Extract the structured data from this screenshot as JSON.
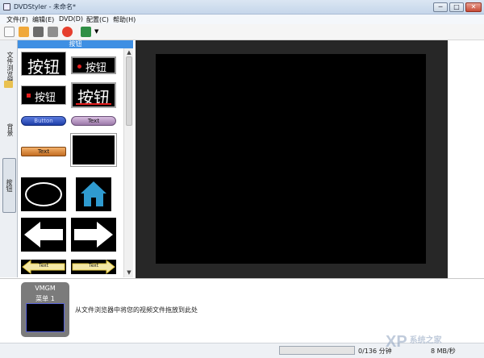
{
  "window": {
    "title": "DVDStyler - 未命名*",
    "min": "─",
    "max": "□",
    "close": "✕"
  },
  "menu": [
    {
      "label": "文件(F)"
    },
    {
      "label": "编辑(E)"
    },
    {
      "label": "DVD(D)"
    },
    {
      "label": "配置(C)"
    },
    {
      "label": "帮助(H)"
    }
  ],
  "toolbar": {
    "buttons": [
      "new-file-icon",
      "open-folder-icon",
      "save-icon",
      "settings-icon",
      "burn-icon",
      "add-file-icon"
    ],
    "colors": {
      "new": "#fafafa",
      "open": "#f0a83a",
      "save": "#6b6b6b",
      "settings": "#8f8f8f",
      "burn": "#e63f2e",
      "add": "#2f8f46"
    }
  },
  "left_tabs": [
    {
      "label": "文件浏览器"
    },
    {
      "label": "背景"
    },
    {
      "label": "按钮"
    }
  ],
  "panel": {
    "header": "按钮",
    "buttons": [
      {
        "text": "按钮",
        "style": "big"
      },
      {
        "text": "按钮",
        "style": "red-dot"
      },
      {
        "text": "按钮",
        "style": "red-dot-small"
      },
      {
        "text": "按钮",
        "style": "big-underline"
      },
      {
        "text": "Button",
        "style": "blue-pill"
      },
      {
        "text": "Text",
        "style": "purple-pill"
      },
      {
        "text": "Text",
        "style": "orange-pill"
      },
      {
        "text": "",
        "style": "black-frame"
      },
      {
        "text": "",
        "style": "ellipse"
      },
      {
        "text": "",
        "style": "house"
      },
      {
        "text": "",
        "style": "arrow-left"
      },
      {
        "text": "",
        "style": "arrow-right"
      },
      {
        "text": "Text",
        "style": "yellow-arrow-left"
      },
      {
        "text": "Text",
        "style": "yellow-arrow-right"
      }
    ]
  },
  "vmgm": {
    "label": "VMGM",
    "menu": "菜单 1"
  },
  "hint_text": "从文件浏览器中将您的视频文件拖放到此处",
  "status": {
    "progress_fraction": 0.0,
    "time": "0/136 分钟",
    "speed": "8 MB/秒"
  },
  "watermark": {
    "text": "XP",
    "sub": "系统之家"
  }
}
